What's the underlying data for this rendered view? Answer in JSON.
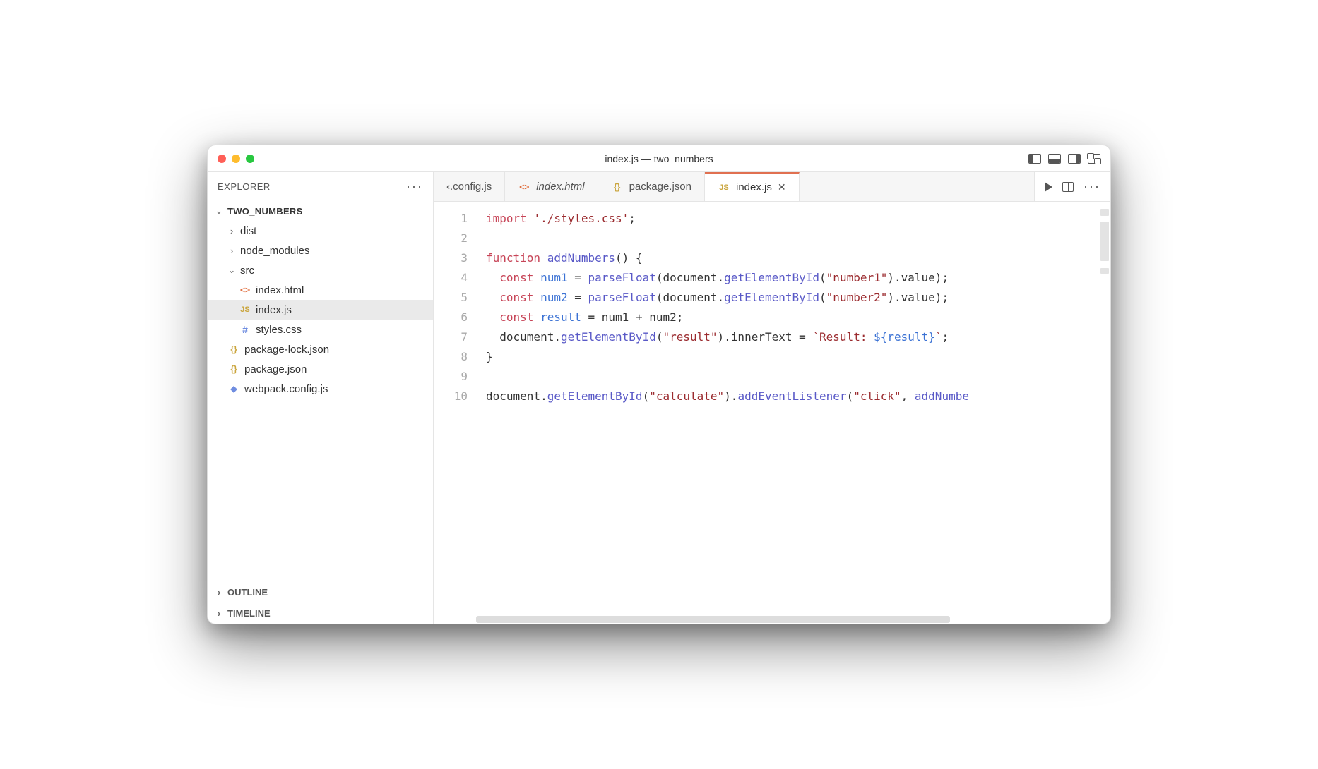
{
  "window": {
    "title": "index.js — two_numbers"
  },
  "explorer": {
    "title": "EXPLORER",
    "root": "TWO_NUMBERS",
    "tree": {
      "dist": "dist",
      "node_modules": "node_modules",
      "src": "src",
      "index_html": "index.html",
      "index_js": "index.js",
      "styles_css": "styles.css",
      "package_lock": "package-lock.json",
      "package_json": "package.json",
      "webpack_config": "webpack.config.js"
    },
    "outline": "OUTLINE",
    "timeline": "TIMELINE"
  },
  "tabs": {
    "t0": "‹.config.js",
    "t1": "index.html",
    "t2": "package.json",
    "t3": "index.js"
  },
  "gutter": {
    "l1": "1",
    "l2": "2",
    "l3": "3",
    "l4": "4",
    "l5": "5",
    "l6": "6",
    "l7": "7",
    "l8": "8",
    "l9": "9",
    "l10": "10"
  },
  "code": {
    "l1": {
      "a": "import",
      "b": "'./styles.css'",
      "c": ";"
    },
    "l3": {
      "a": "function",
      "b": "addNumbers",
      "c": "() {"
    },
    "l4": {
      "a": "const",
      "b": "num1",
      "c": " = ",
      "d": "parseFloat",
      "e": "(document.",
      "f": "getElementById",
      "g": "(",
      "h": "\"number1\"",
      "i": ").value);"
    },
    "l5": {
      "a": "const",
      "b": "num2",
      "c": " = ",
      "d": "parseFloat",
      "e": "(document.",
      "f": "getElementById",
      "g": "(",
      "h": "\"number2\"",
      "i": ").value);"
    },
    "l6": {
      "a": "const",
      "b": "result",
      "c": " = num1 + num2;"
    },
    "l7": {
      "a": "  document.",
      "b": "getElementById",
      "c": "(",
      "d": "\"result\"",
      "e": ").innerText = ",
      "f": "`Result: ",
      "g": "${",
      "h": "result",
      "i": "}",
      "j": "`",
      "k": ";"
    },
    "l8": {
      "a": "}"
    },
    "l10": {
      "a": "document.",
      "b": "getElementById",
      "c": "(",
      "d": "\"calculate\"",
      "e": ").",
      "f": "addEventListener",
      "g": "(",
      "h": "\"click\"",
      "i": ", ",
      "j": "addNumbe"
    }
  }
}
